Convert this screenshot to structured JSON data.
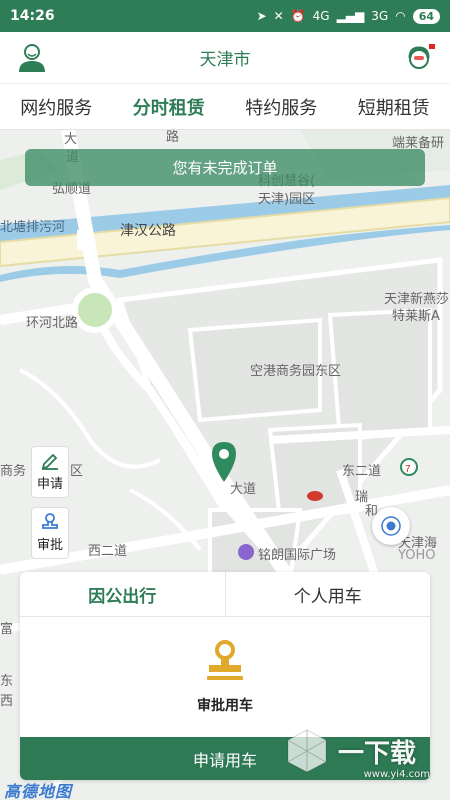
{
  "status_bar": {
    "time": "14:26",
    "battery": "64",
    "signal_a": "4G",
    "signal_b": "3G"
  },
  "header": {
    "title": "天津市"
  },
  "tabs": [
    {
      "label": "网约服务"
    },
    {
      "label": "分时租赁",
      "active": true
    },
    {
      "label": "特约服务"
    },
    {
      "label": "短期租赁"
    }
  ],
  "banner": {
    "text": "您有未完成订单"
  },
  "side_buttons": {
    "apply": "申请",
    "approve": "审批"
  },
  "map_labels": {
    "road_jinhan": "津汉公路",
    "road_huanhe": "环河北路",
    "road_hongshun": "弘顺道",
    "road_beitang": "北塘排污河",
    "road_dong2": "东二道",
    "road_xi2": "西二道",
    "area_airport_east": "空港商务园东区",
    "area_tech_line1": "科创慧谷(",
    "area_tech_line2": "天津)园区",
    "poi_tianjin_new1": "天津新燕莎",
    "poi_tianjin_new2": "特莱斯A",
    "poi_minglang": "铭朗国际广场",
    "poi_tianjinhai": "天津海",
    "poi_yoho": "YOHO",
    "poi_duanlai": "端莱备研",
    "road_da": "大",
    "road_dao": "道",
    "road_lu": "路",
    "road_shang": "商务",
    "road_qu": "区",
    "road_fu": "富",
    "road_dong": "东",
    "road_xi": "西",
    "road_dadao": "大道",
    "road_rui": "瑞",
    "road_he": "和"
  },
  "panel": {
    "tabs": [
      {
        "label": "因公出行",
        "active": true
      },
      {
        "label": "个人用车"
      }
    ],
    "action_label": "审批用车",
    "apply_button": "申请用车"
  },
  "map_brand": "高德地图",
  "watermark": {
    "text": "一下载",
    "url": "www.yi4.com"
  },
  "colors": {
    "primary": "#2e7d57",
    "river": "#9ccbe8",
    "road": "#ffffff",
    "accent_gold": "#e0a92b"
  }
}
